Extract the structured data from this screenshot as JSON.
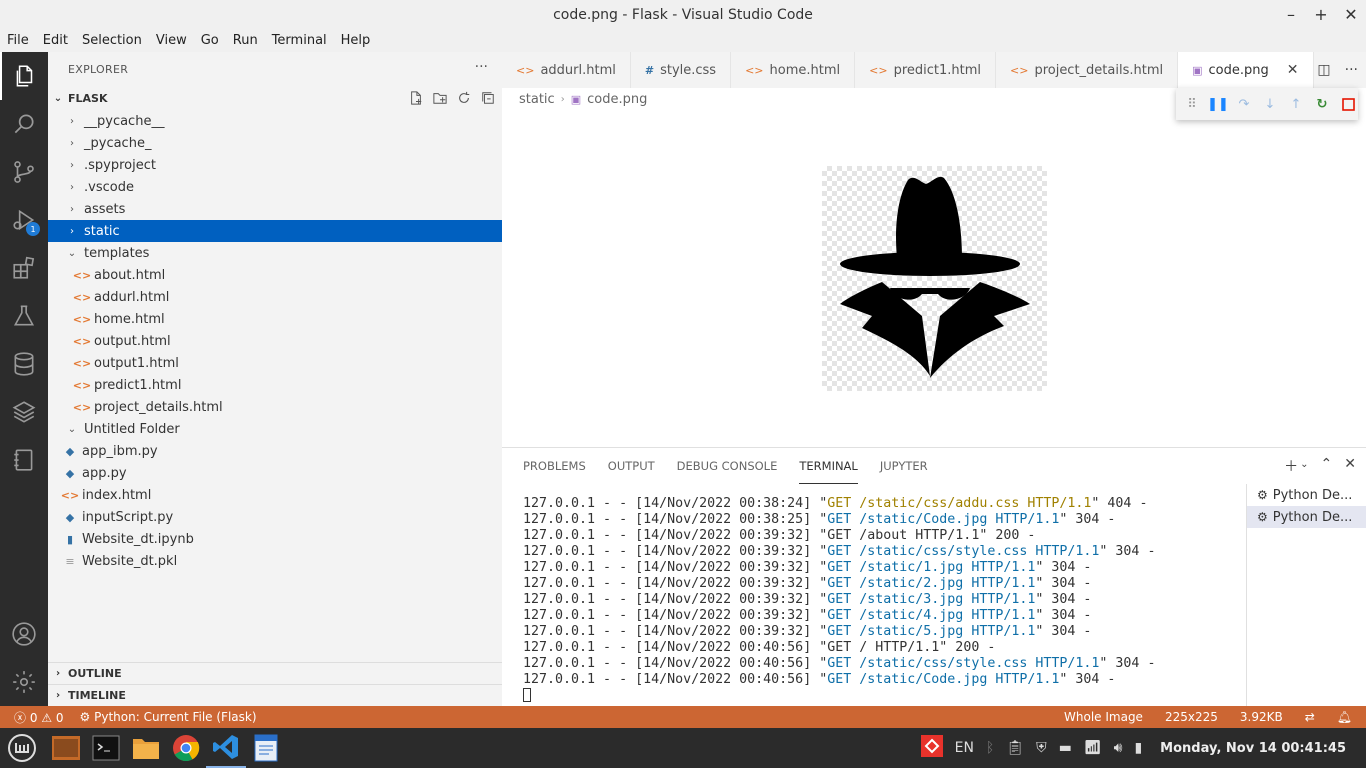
{
  "window": {
    "title": "code.png - Flask - Visual Studio Code",
    "controls": [
      "–",
      "+",
      "✕"
    ]
  },
  "menu": [
    "File",
    "Edit",
    "Selection",
    "View",
    "Go",
    "Run",
    "Terminal",
    "Help"
  ],
  "activity": {
    "items": [
      "explorer-icon",
      "search-icon",
      "source-control-icon",
      "run-debug-icon",
      "extensions-icon",
      "testing-icon",
      "database-icon",
      "layers-icon",
      "notebook-icon"
    ],
    "debug_badge": "1",
    "bottom": [
      "account-icon",
      "gear-icon"
    ]
  },
  "sidebar": {
    "header": "EXPLORER",
    "folder": "FLASK",
    "tree": [
      {
        "label": "__pycache__",
        "type": "folder",
        "open": false
      },
      {
        "label": "_pycache_",
        "type": "folder",
        "open": false
      },
      {
        "label": ".spyproject",
        "type": "folder",
        "open": false
      },
      {
        "label": ".vscode",
        "type": "folder",
        "open": false
      },
      {
        "label": "assets",
        "type": "folder",
        "open": false
      },
      {
        "label": "static",
        "type": "folder",
        "open": false,
        "selected": true
      },
      {
        "label": "templates",
        "type": "folder",
        "open": true
      },
      {
        "label": "about.html",
        "type": "html",
        "indent": 1
      },
      {
        "label": "addurl.html",
        "type": "html",
        "indent": 1
      },
      {
        "label": "home.html",
        "type": "html",
        "indent": 1
      },
      {
        "label": "output.html",
        "type": "html",
        "indent": 1
      },
      {
        "label": "output1.html",
        "type": "html",
        "indent": 1
      },
      {
        "label": "predict1.html",
        "type": "html",
        "indent": 1
      },
      {
        "label": "project_details.html",
        "type": "html",
        "indent": 1
      },
      {
        "label": "Untitled Folder",
        "type": "folder",
        "open": true
      },
      {
        "label": "app_ibm.py",
        "type": "py"
      },
      {
        "label": "app.py",
        "type": "py"
      },
      {
        "label": "index.html",
        "type": "html"
      },
      {
        "label": "inputScript.py",
        "type": "py"
      },
      {
        "label": "Website_dt.ipynb",
        "type": "nb"
      },
      {
        "label": "Website_dt.pkl",
        "type": "pkl"
      }
    ],
    "outline": "OUTLINE",
    "timeline": "TIMELINE"
  },
  "tabs": [
    {
      "label": "addurl.html",
      "icon": "html"
    },
    {
      "label": "style.css",
      "icon": "css"
    },
    {
      "label": "home.html",
      "icon": "html"
    },
    {
      "label": "predict1.html",
      "icon": "html"
    },
    {
      "label": "project_details.html",
      "icon": "html"
    },
    {
      "label": "code.png",
      "icon": "image",
      "active": true
    }
  ],
  "breadcrumb": {
    "folder": "static",
    "file": "code.png"
  },
  "panel": {
    "tabs": [
      "PROBLEMS",
      "OUTPUT",
      "DEBUG CONSOLE",
      "TERMINAL",
      "JUPYTER"
    ],
    "active_tab": "TERMINAL",
    "terminal_lines": [
      {
        "prefix": "127.0.0.1 - - [14/Nov/2022 00:38:24] \"",
        "req": "GET /static/css/addu.css HTTP/1.1",
        "suffix": "\" 404 -",
        "kind": "warn"
      },
      {
        "prefix": "127.0.0.1 - - [14/Nov/2022 00:38:25] \"",
        "req": "GET /static/Code.jpg HTTP/1.1",
        "suffix": "\" 304 -",
        "kind": "req"
      },
      {
        "prefix": "127.0.0.1 - - [14/Nov/2022 00:39:32] \"",
        "req": "GET /about HTTP/1.1",
        "suffix": "\" 200 -",
        "kind": "plain"
      },
      {
        "prefix": "127.0.0.1 - - [14/Nov/2022 00:39:32] \"",
        "req": "GET /static/css/style.css HTTP/1.1",
        "suffix": "\" 304 -",
        "kind": "req"
      },
      {
        "prefix": "127.0.0.1 - - [14/Nov/2022 00:39:32] \"",
        "req": "GET /static/1.jpg HTTP/1.1",
        "suffix": "\" 304 -",
        "kind": "req"
      },
      {
        "prefix": "127.0.0.1 - - [14/Nov/2022 00:39:32] \"",
        "req": "GET /static/2.jpg HTTP/1.1",
        "suffix": "\" 304 -",
        "kind": "req"
      },
      {
        "prefix": "127.0.0.1 - - [14/Nov/2022 00:39:32] \"",
        "req": "GET /static/3.jpg HTTP/1.1",
        "suffix": "\" 304 -",
        "kind": "req"
      },
      {
        "prefix": "127.0.0.1 - - [14/Nov/2022 00:39:32] \"",
        "req": "GET /static/4.jpg HTTP/1.1",
        "suffix": "\" 304 -",
        "kind": "req"
      },
      {
        "prefix": "127.0.0.1 - - [14/Nov/2022 00:39:32] \"",
        "req": "GET /static/5.jpg HTTP/1.1",
        "suffix": "\" 304 -",
        "kind": "req"
      },
      {
        "prefix": "127.0.0.1 - - [14/Nov/2022 00:40:56] \"",
        "req": "GET / HTTP/1.1",
        "suffix": "\" 200 -",
        "kind": "plain"
      },
      {
        "prefix": "127.0.0.1 - - [14/Nov/2022 00:40:56] \"",
        "req": "GET /static/css/style.css HTTP/1.1",
        "suffix": "\" 304 -",
        "kind": "req"
      },
      {
        "prefix": "127.0.0.1 - - [14/Nov/2022 00:40:56] \"",
        "req": "GET /static/Code.jpg HTTP/1.1",
        "suffix": "\" 304 -",
        "kind": "req"
      }
    ],
    "terminals": [
      "Python De...",
      "Python De..."
    ]
  },
  "statusbar": {
    "errors": "0",
    "warnings": "0",
    "debug_config": "Python: Current File (Flask)",
    "zoom": "Whole Image",
    "dimensions": "225x225",
    "size": "3.92KB"
  },
  "taskbar": {
    "apps": [
      "mint-menu-icon",
      "files-icon",
      "terminal-icon",
      "folder-icon",
      "chrome-icon",
      "vscode-icon",
      "document-icon"
    ],
    "lang": "EN",
    "clock": "Monday, Nov 14 00:41:45"
  },
  "colors": {
    "activitybar": "#2c2c2c",
    "statusbar": "#cc6633",
    "selection": "#0060c0",
    "request_text": "#0f6fa8"
  }
}
